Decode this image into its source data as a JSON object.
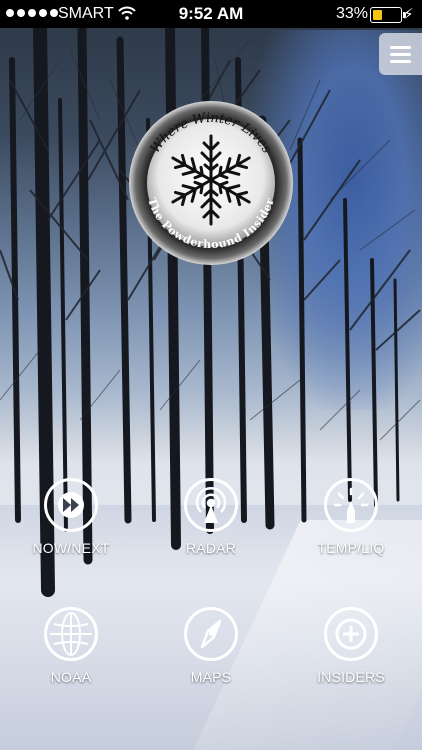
{
  "status_bar": {
    "carrier": "SMART",
    "time": "9:52 AM",
    "battery_percent": "33%"
  },
  "logo": {
    "top_text": "Where Winter Lives",
    "bottom_text": "The Powderhound Insider"
  },
  "menu": {
    "icon": "hamburger-menu-icon"
  },
  "tiles": [
    {
      "label": "NOW/NEXT",
      "icon": "fast-forward-icon"
    },
    {
      "label": "RADAR",
      "icon": "radar-icon"
    },
    {
      "label": "TEMP/LIQ",
      "icon": "gauge-icon"
    },
    {
      "label": "NOAA",
      "icon": "globe-icon"
    },
    {
      "label": "MAPS",
      "icon": "compass-icon"
    },
    {
      "label": "INSIDERS",
      "icon": "plus-icon"
    }
  ],
  "colors": {
    "battery_fill": "#f2c513",
    "icon": "#ffffff"
  }
}
